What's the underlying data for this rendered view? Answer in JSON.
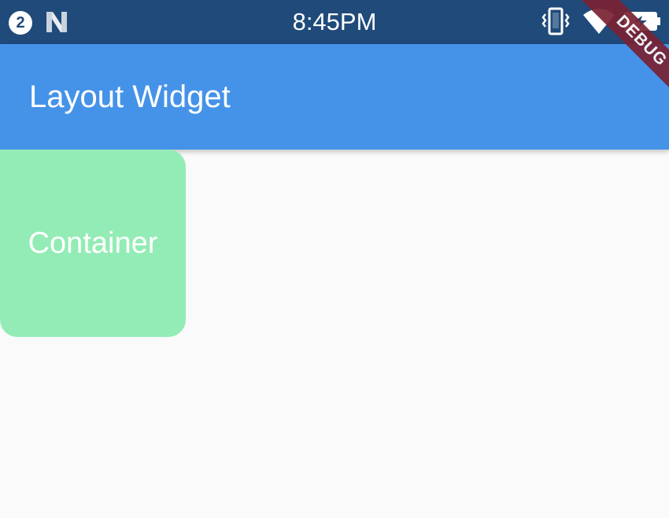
{
  "status_bar": {
    "notification_count": "2",
    "time": "8:45PM",
    "icons": [
      "notification-count-icon",
      "n-icon",
      "vibrate-icon",
      "wifi-icon",
      "battery-icon"
    ]
  },
  "app_bar": {
    "title": "Layout Widget"
  },
  "debug_banner": {
    "label": "DEBUG"
  },
  "container": {
    "label": "Container"
  },
  "colors": {
    "status_bar": "#1f4a7a",
    "app_bar": "#4593e8",
    "background": "#fafafa",
    "container": "#93ecb5",
    "debug_banner": "#7a2233",
    "text": "#ffffff"
  }
}
